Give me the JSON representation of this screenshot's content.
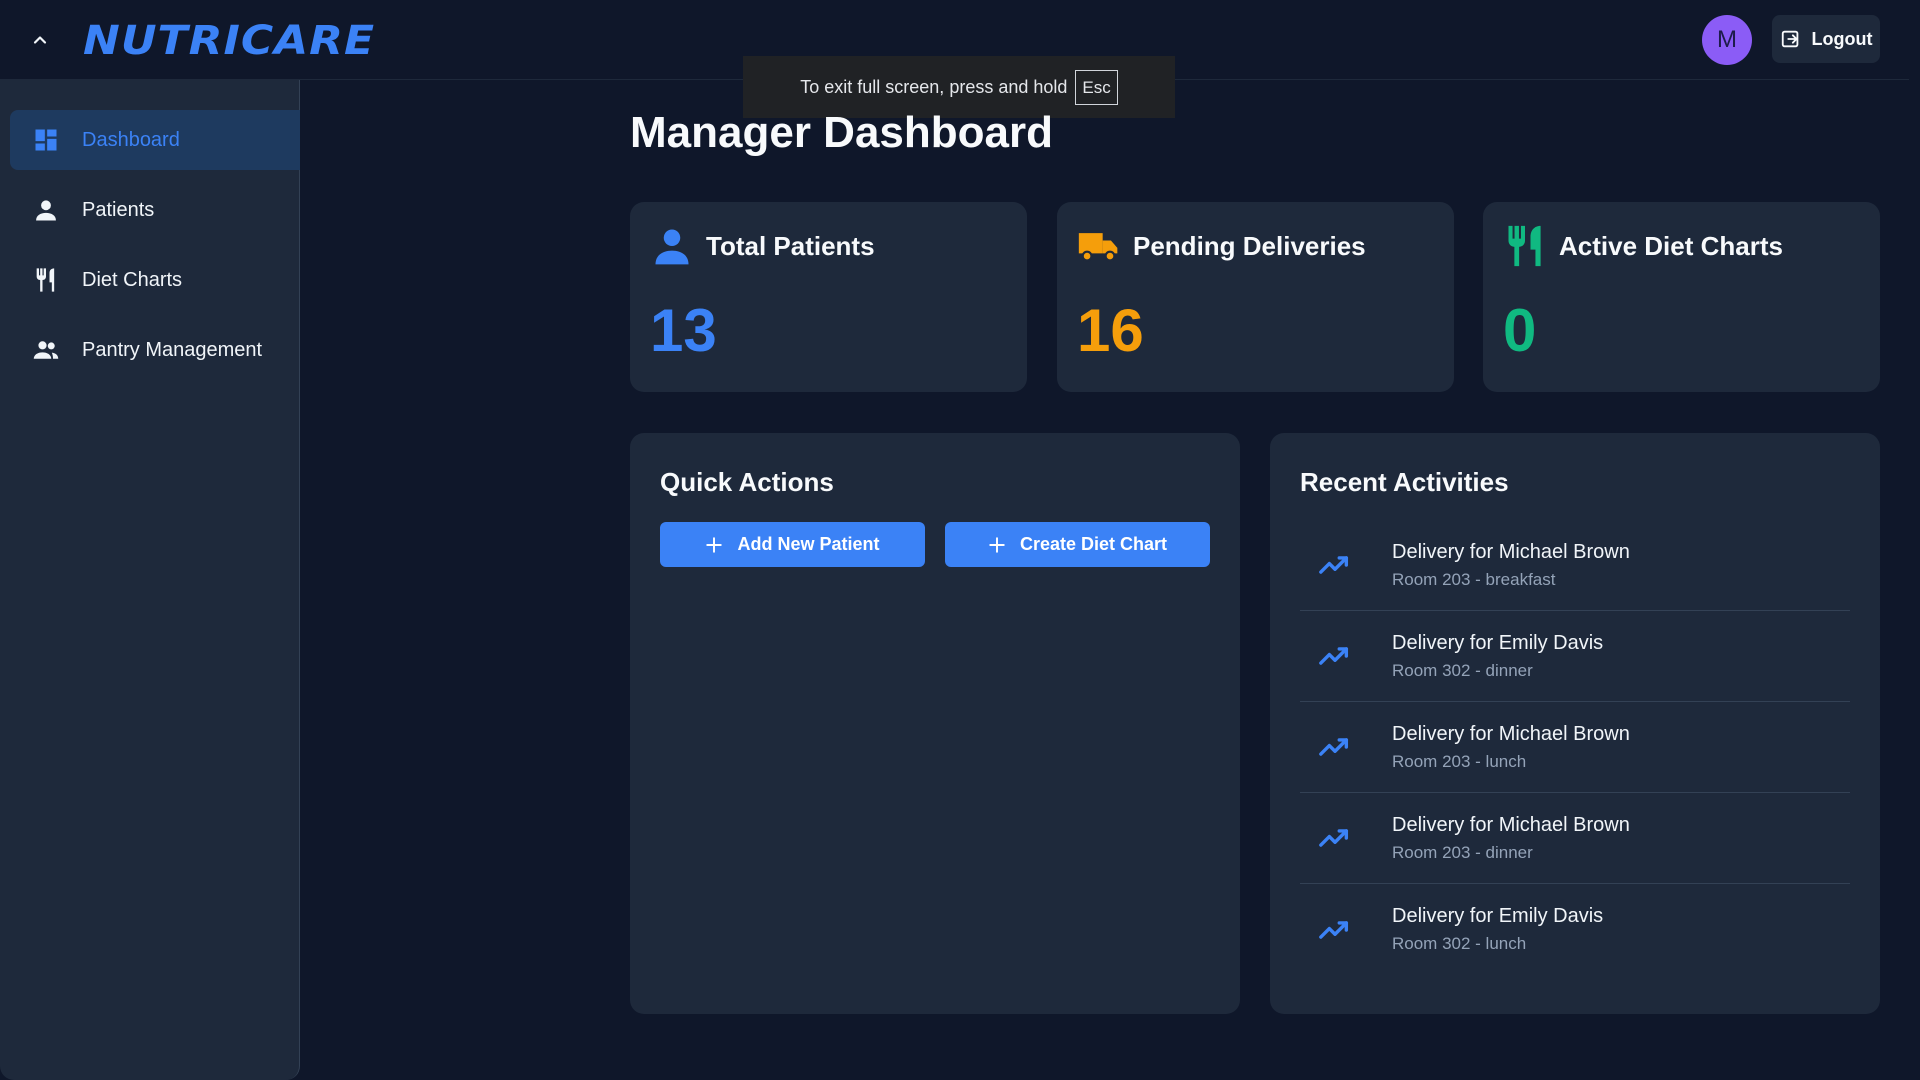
{
  "header": {
    "logo_text": "NUTRICARE",
    "avatar_initial": "M",
    "logout_label": "Logout",
    "collapse_icon": "chevron-up-icon"
  },
  "fullscreen_toast": {
    "message": "To exit full screen, press and hold",
    "key": "Esc"
  },
  "sidebar": {
    "items": [
      {
        "label": "Dashboard",
        "icon": "dashboard-icon",
        "active": true
      },
      {
        "label": "Patients",
        "icon": "person-icon",
        "active": false
      },
      {
        "label": "Diet Charts",
        "icon": "utensils-icon",
        "active": false
      },
      {
        "label": "Pantry Management",
        "icon": "people-icon",
        "active": false
      }
    ]
  },
  "main": {
    "title": "Manager Dashboard",
    "stats": [
      {
        "title": "Total Patients",
        "value": "13",
        "icon": "person-icon",
        "color": "#3b82f6"
      },
      {
        "title": "Pending Deliveries",
        "value": "16",
        "icon": "truck-icon",
        "color": "#f59e0b"
      },
      {
        "title": "Active Diet Charts",
        "value": "0",
        "icon": "utensils-icon",
        "color": "#10b981"
      }
    ],
    "quick_actions": {
      "title": "Quick Actions",
      "buttons": [
        {
          "label": "Add New Patient",
          "icon": "plus-icon"
        },
        {
          "label": "Create Diet Chart",
          "icon": "plus-icon"
        }
      ]
    },
    "recent_activities": {
      "title": "Recent Activities",
      "icon": "trending-up-icon",
      "items": [
        {
          "title": "Delivery for Michael Brown",
          "subtitle": "Room 203 - breakfast"
        },
        {
          "title": "Delivery for Emily Davis",
          "subtitle": "Room 302 - dinner"
        },
        {
          "title": "Delivery for Michael Brown",
          "subtitle": "Room 203 - lunch"
        },
        {
          "title": "Delivery for Michael Brown",
          "subtitle": "Room 203 - dinner"
        },
        {
          "title": "Delivery for Emily Davis",
          "subtitle": "Room 302 - lunch"
        }
      ]
    }
  },
  "colors": {
    "background": "#0f172a",
    "card": "#1e293b",
    "accent": "#3b82f6",
    "avatar": "#8b5cf6"
  }
}
